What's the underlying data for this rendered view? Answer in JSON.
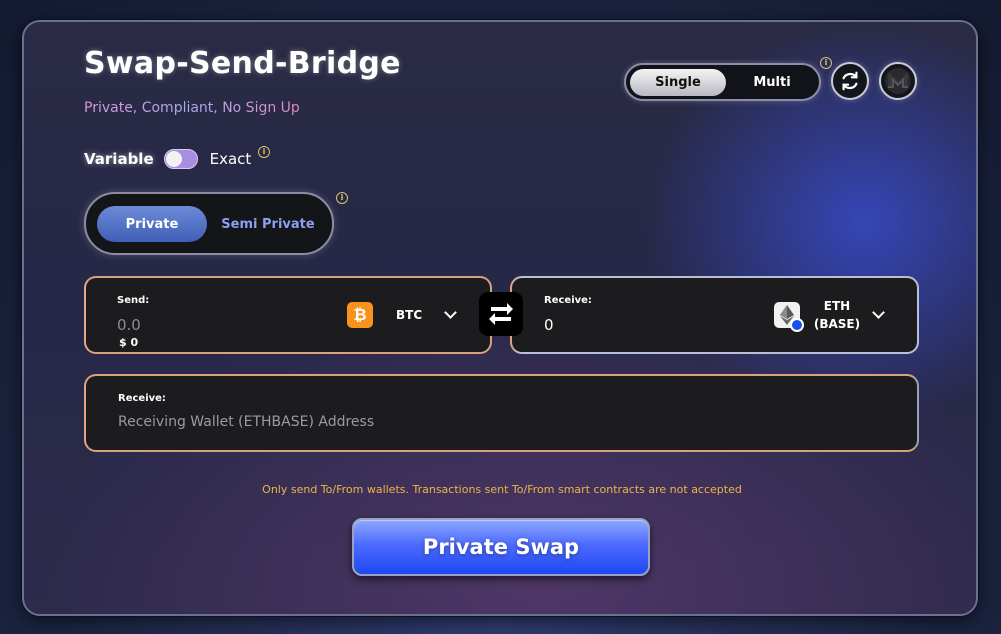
{
  "header": {
    "title": "Swap-Send-Bridge",
    "subtitle": "Private, Compliant, No Sign Up"
  },
  "mode_toggle": {
    "options": [
      "Single",
      "Multi"
    ],
    "selected": "Single"
  },
  "info_icon_glyph": "i",
  "rate_toggle": {
    "left_label": "Variable",
    "right_label": "Exact",
    "state": "Variable"
  },
  "privacy_toggle": {
    "options": [
      "Private",
      "Semi Private"
    ],
    "selected": "Private"
  },
  "send": {
    "label": "Send:",
    "amount_placeholder": "0.0",
    "usd_value": "$ 0",
    "coin": "BTC",
    "coin_icon": "bitcoin-icon",
    "coin_color": "#f7931a"
  },
  "receive": {
    "label": "Receive:",
    "amount": "0",
    "coin_line1": "ETH",
    "coin_line2": "(BASE)",
    "coin_icon": "ethereum-base-icon",
    "base_badge_color": "#1652f0"
  },
  "address": {
    "label": "Receive:",
    "placeholder": "Receiving Wallet (ETHBASE) Address"
  },
  "warning": "Only send To/From wallets. Transactions sent To/From smart contracts are not accepted",
  "cta": {
    "label": "Private Swap"
  },
  "colors": {
    "accent_blue": "#3f5fff",
    "warning_orange": "#f0b347"
  }
}
